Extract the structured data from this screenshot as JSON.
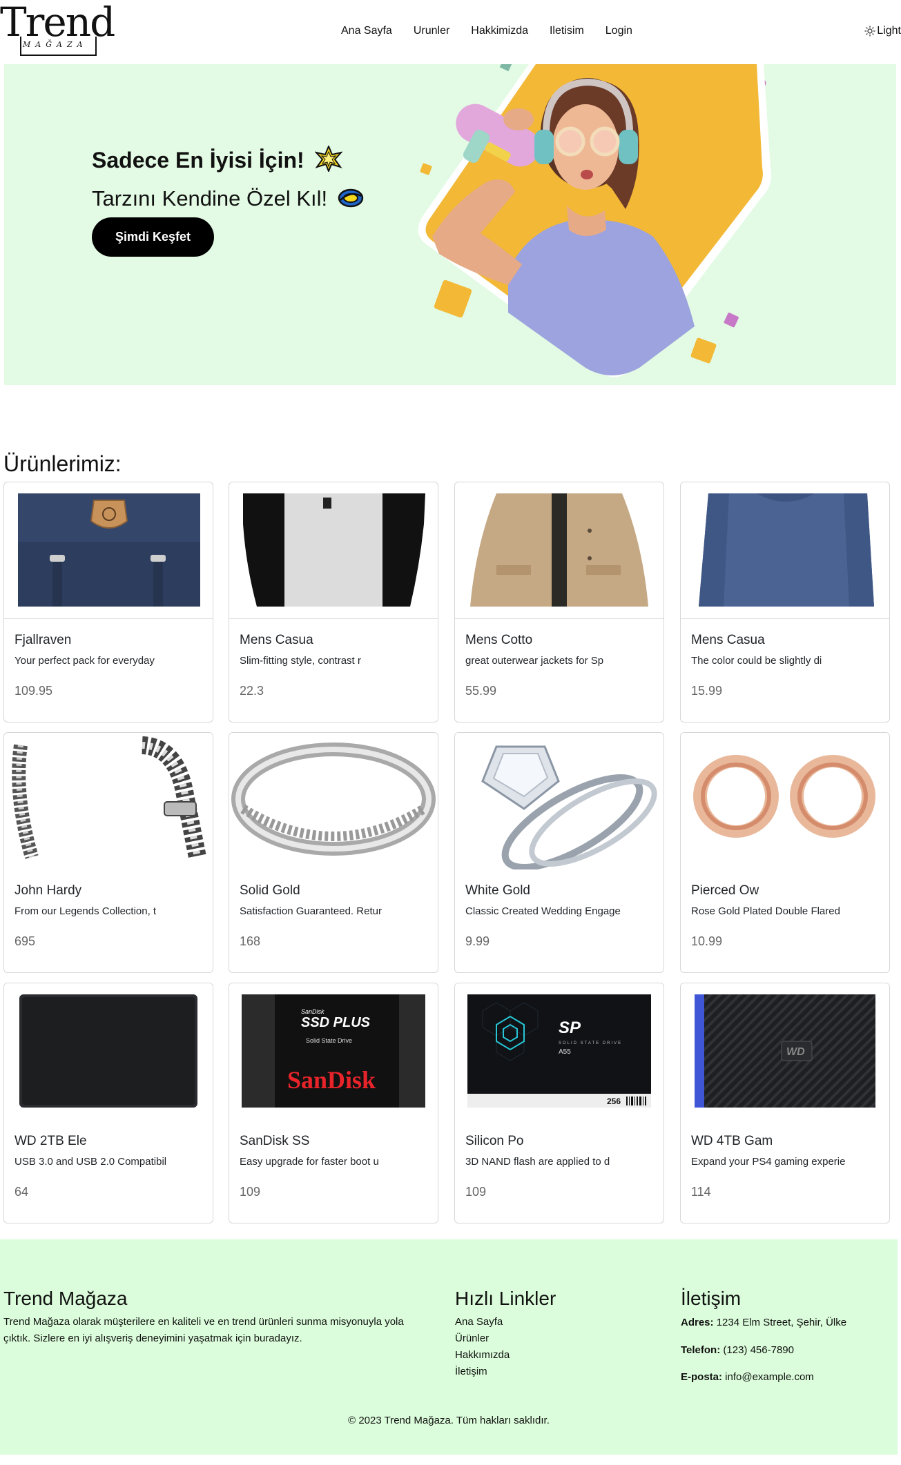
{
  "nav": {
    "logo_text": "Trend",
    "logo_sub": "MAĞAZA",
    "links": [
      "Ana Sayfa",
      "Urunler",
      "Hakkimizda",
      "Iletisim",
      "Login"
    ],
    "theme_label": "Light"
  },
  "hero": {
    "headline": "Sadece En İyisi İçin!",
    "subheadline": "Tarzını Kendine Özel Kıl!",
    "cta": "Şimdi Keşfet",
    "colors": {
      "bg": "#e3fbe4",
      "accent": "#f2b836",
      "pink": "#c779c7"
    }
  },
  "products": {
    "title": "Ürünlerimiz:",
    "items": [
      {
        "title": "Fjallraven",
        "desc": "Your perfect pack for everyday",
        "price": "109.95",
        "icon": "backpack-image"
      },
      {
        "title": "Mens Casua",
        "desc": "Slim-fitting style, contrast r",
        "price": "22.3",
        "icon": "tshirt-image"
      },
      {
        "title": "Mens Cotto",
        "desc": "great outerwear jackets for Sp",
        "price": "55.99",
        "icon": "jacket-image"
      },
      {
        "title": "Mens Casua",
        "desc": "The color could be slightly di",
        "price": "15.99",
        "icon": "longsleeve-image"
      },
      {
        "title": "John Hardy",
        "desc": "From our Legends Collection, t",
        "price": "695",
        "icon": "bracelet-image"
      },
      {
        "title": "Solid Gold",
        "desc": "Satisfaction Guaranteed. Retur",
        "price": "168",
        "icon": "ring-image"
      },
      {
        "title": "White Gold",
        "desc": "Classic Created Wedding Engage",
        "price": "9.99",
        "icon": "diamond-ring-image"
      },
      {
        "title": "Pierced Ow",
        "desc": "Rose Gold Plated Double Flared",
        "price": "10.99",
        "icon": "earring-plugs-image"
      },
      {
        "title": "WD 2TB Ele",
        "desc": "USB 3.0 and USB 2.0 Compatibil",
        "price": "64",
        "icon": "hard-drive-image"
      },
      {
        "title": "SanDisk SS",
        "desc": "Easy upgrade for faster boot u",
        "price": "109",
        "icon": "sandisk-ssd-image"
      },
      {
        "title": "Silicon Po",
        "desc": "3D NAND flash are applied to d",
        "price": "109",
        "icon": "silicon-power-ssd-image"
      },
      {
        "title": "WD 4TB Gam",
        "desc": "Expand your PS4 gaming experie",
        "price": "114",
        "icon": "wd-gaming-drive-image"
      }
    ],
    "image_labels": {
      "sandisk_top": "SanDisk",
      "sandisk_model": "SSD PLUS",
      "sandisk_sub": "Solid State Drive",
      "sandisk_brand": "SanDisk",
      "sp_logo": "SP",
      "sp_sub": "SOLID STATE DRIVE",
      "sp_model": "A55",
      "sp_capacity": "256",
      "wd_logo": "WD"
    }
  },
  "footer": {
    "about_title": "Trend Mağaza",
    "about_text": "Trend Mağaza olarak müşterilere en kaliteli ve en trend ürünleri sunma misyonuyla yola çıktık. Sizlere en iyi alışveriş deneyimini yaşatmak için buradayız.",
    "links_title": "Hızlı Linkler",
    "links": [
      "Ana Sayfa",
      "Ürünler",
      "Hakkımızda",
      "İletişim"
    ],
    "contact_title": "İletişim",
    "address_label": "Adres:",
    "address": "1234 Elm Street, Şehir, Ülke",
    "phone_label": "Telefon:",
    "phone": "(123) 456-7890",
    "email_label": "E-posta:",
    "email": "info@example.com",
    "copyright": "© 2023 Trend Mağaza. Tüm hakları saklıdır.",
    "bg": "#dbfddb"
  }
}
